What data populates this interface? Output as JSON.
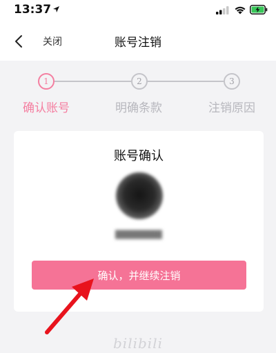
{
  "status_bar": {
    "time": "13:37"
  },
  "nav": {
    "back_icon": "chevron-left-icon",
    "close_label": "关闭",
    "title": "账号注销"
  },
  "steps": [
    {
      "number": "1",
      "label": "确认账号",
      "active": true
    },
    {
      "number": "2",
      "label": "明确条款",
      "active": false
    },
    {
      "number": "3",
      "label": "注销原因",
      "active": false
    }
  ],
  "card": {
    "title": "账号确认",
    "username": "████████",
    "confirm_label": "确认，并继续注销"
  },
  "footer": {
    "logo_text": "bilibili"
  },
  "colors": {
    "accent": "#f57396",
    "step_active": "#f47ea0",
    "step_inactive": "#c4c4c9",
    "annotation": "#e8131d"
  }
}
